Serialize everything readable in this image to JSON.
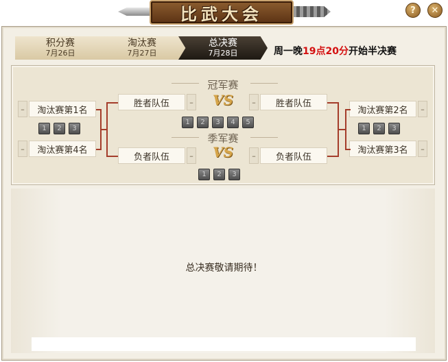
{
  "title": "比武大会",
  "help_label": "?",
  "close_label": "✕",
  "tabs": [
    {
      "label": "积分赛",
      "date": "7月26日"
    },
    {
      "label": "淘汰赛",
      "date": "7月27日"
    },
    {
      "label": "总决赛",
      "date": "7月28日"
    }
  ],
  "notice": {
    "prefix": "周一晚",
    "time": "19点20分",
    "suffix": "开始半决赛"
  },
  "bracket": {
    "final_title": "冠军赛",
    "third_title": "季军赛",
    "vs": "VS",
    "slot_dash": "–",
    "left_top": "淘汰赛第1名",
    "left_bottom": "淘汰赛第4名",
    "right_top": "淘汰赛第2名",
    "right_bottom": "淘汰赛第3名",
    "winner_left": "胜者队伍",
    "winner_right": "胜者队伍",
    "loser_left": "负者队伍",
    "loser_right": "负者队伍",
    "semi_left_games": [
      "1",
      "2",
      "3"
    ],
    "semi_right_games": [
      "1",
      "2",
      "3"
    ],
    "final_games": [
      "1",
      "2",
      "3",
      "4",
      "5"
    ],
    "third_games": [
      "1",
      "2",
      "3"
    ]
  },
  "message": "总决赛敬请期待！"
}
